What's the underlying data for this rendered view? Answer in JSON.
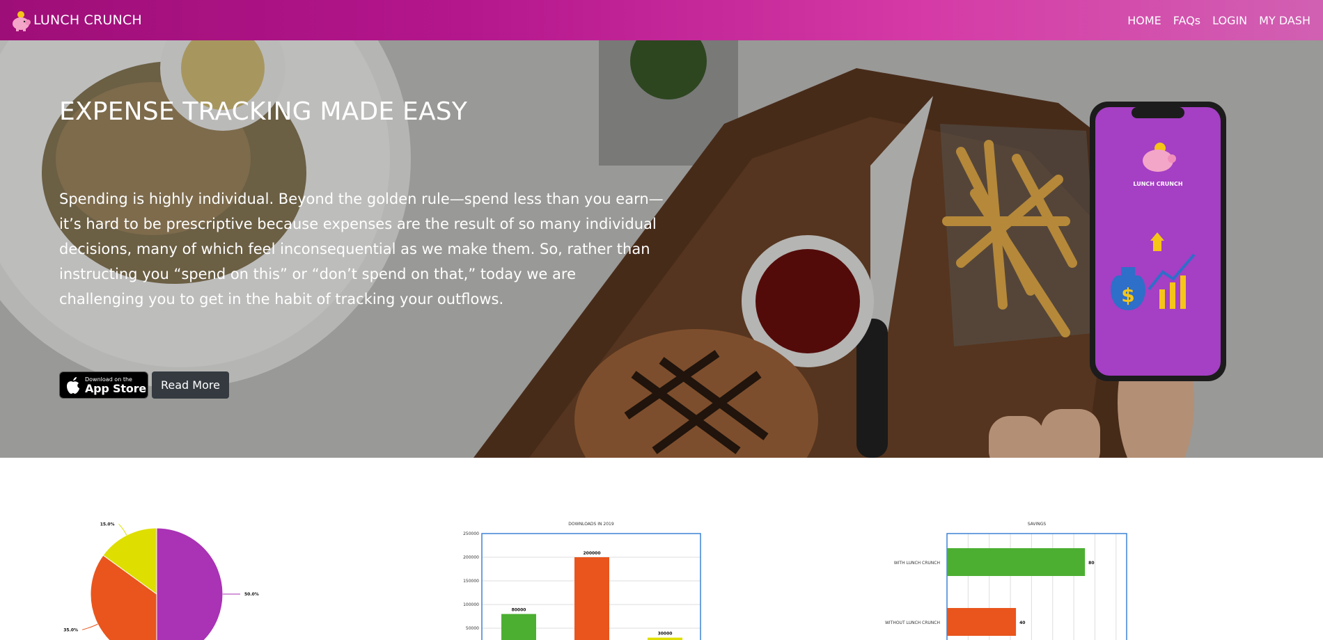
{
  "navbar": {
    "brand": "LUNCH CRUNCH",
    "links": [
      "HOME",
      "FAQs",
      "LOGIN",
      "MY DASH"
    ]
  },
  "hero": {
    "title": "EXPENSE TRACKING MADE EASY",
    "text": "Spending is highly individual. Beyond the golden rule—spend less than you earn—it’s hard to be prescriptive because expenses are the result of so many individual decisions, many of which feel inconsequential as we make them. So, rather than instructing you “spend on this” or “don’t spend on that,” today we are challenging you to get in the habit of tracking your outflows.",
    "appstore_small": "Download on the",
    "appstore_big": "App Store",
    "read_more": "Read More",
    "phone_brand": "LUNCH CRUNCH"
  },
  "colors": {
    "purple": "#a932b5",
    "orange": "#e9551c",
    "yellow": "#dede00",
    "green": "#4caf32",
    "nav_start": "#9e0e78",
    "nav_end": "#d160b2"
  },
  "chart_data": [
    {
      "type": "pie",
      "labels": [],
      "values": [
        50.0,
        35.0,
        15.0
      ],
      "value_labels": [
        "50.0%",
        "35.0%",
        "15.0%"
      ],
      "colors": [
        "#a932b5",
        "#e9551c",
        "#dede00"
      ]
    },
    {
      "type": "bar",
      "title": "DOWNLOADS IN 2019",
      "categories": [
        "",
        "",
        ""
      ],
      "values": [
        80000,
        200000,
        30000
      ],
      "value_labels": [
        "80000",
        "200000",
        "30000"
      ],
      "colors": [
        "#4caf32",
        "#e9551c",
        "#dede00"
      ],
      "ylim": [
        0,
        250000
      ],
      "yticks": [
        "250000",
        "200000",
        "150000",
        "100000",
        "50000"
      ]
    },
    {
      "type": "bar",
      "orientation": "horizontal",
      "title": "SAVINGS",
      "categories": [
        "WITH LUNCH CRUNCH",
        "WITHOUT LUNCH CRUNCH"
      ],
      "values": [
        80,
        40
      ],
      "value_labels": [
        "80",
        "40"
      ],
      "colors": [
        "#4caf32",
        "#e9551c"
      ]
    }
  ]
}
